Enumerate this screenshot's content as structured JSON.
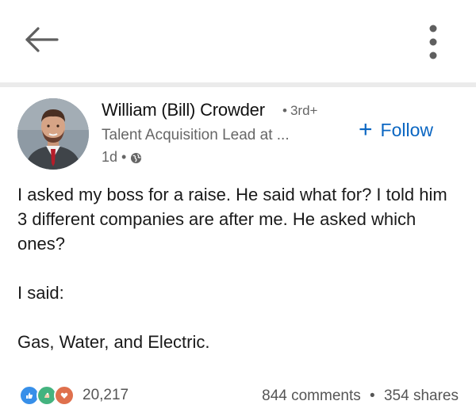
{
  "header": {
    "back_icon": "arrow-left-icon",
    "more_icon": "vertical-dots-icon"
  },
  "author": {
    "name": "William (Bill) Crowder",
    "degree": "3rd+",
    "headline": "Talent Acquisition Lead at ...",
    "time": "1d",
    "visibility_icon": "globe-icon"
  },
  "follow": {
    "label": "Follow",
    "color": "#0a66c2"
  },
  "post": {
    "paragraph1": "I asked my boss for a raise. He said what for? I told him 3 different companies are after me. He asked which ones?",
    "paragraph2": "I said:",
    "paragraph3": "Gas, Water, and Electric."
  },
  "engagement": {
    "reactions_count": "20,217",
    "comments": "844 comments",
    "shares": "354 shares",
    "reaction_icons": [
      "like-icon",
      "celebrate-icon",
      "love-icon"
    ]
  }
}
